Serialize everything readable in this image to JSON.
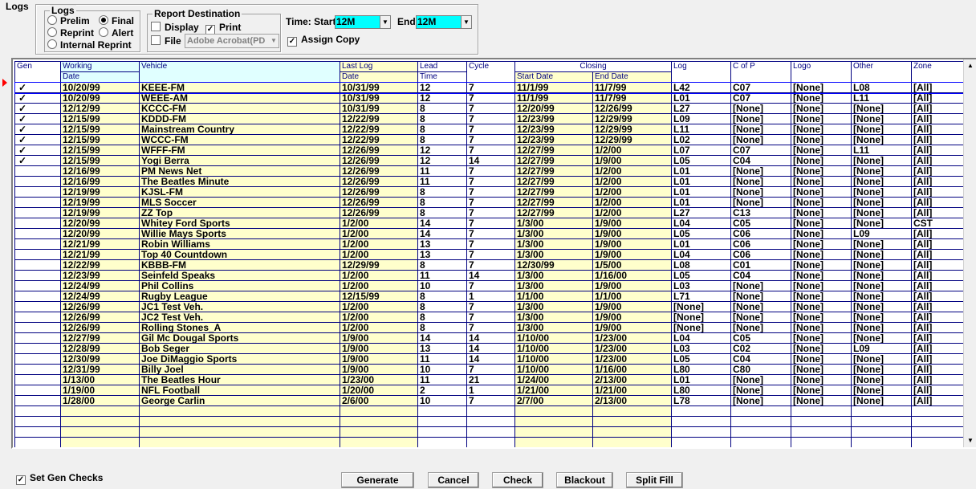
{
  "logs_group": {
    "title": "Logs",
    "kind_label": "Logs",
    "options": [
      {
        "label": "Prelim",
        "checked": false
      },
      {
        "label": "Final",
        "checked": true
      },
      {
        "label": "Reprint",
        "checked": false
      },
      {
        "label": "Alert",
        "checked": false
      },
      {
        "label": "Internal Reprint",
        "checked": false
      }
    ]
  },
  "report_destination": {
    "title": "Report Destination",
    "display_label": "Display",
    "print_label": "Print",
    "file_label": "File",
    "file_format_value": "Adobe Acrobat(PD",
    "display_checked": false,
    "print_checked": true,
    "file_checked": false
  },
  "time": {
    "start_label": "Time: Start",
    "start_value": "12M",
    "end_label": "End",
    "end_value": "12M",
    "assign_copy_label": "Assign Copy",
    "assign_copy_checked": true
  },
  "grid": {
    "headers": {
      "gen": "Gen",
      "working": "Working",
      "working_sub": "Date",
      "vehicle": "Vehicle",
      "last_log": "Last Log",
      "last_log_sub": "Date",
      "lead": "Lead",
      "lead_sub": "Time",
      "cycle": "Cycle",
      "closing": "Closing",
      "start_date": "Start Date",
      "end_date": "End Date",
      "log": "Log",
      "cofp": "C of P",
      "logo": "Logo",
      "other": "Other",
      "zone": "Zone"
    },
    "rows": [
      {
        "gen": "✓",
        "wd": "10/20/99",
        "veh": "KEEE-FM",
        "lld": "10/31/99",
        "lead": "12",
        "cyc": "7",
        "sd": "11/1/99",
        "ed": "11/7/99",
        "log": "L42",
        "cofp": "C07",
        "logo": "[None]",
        "other": "L08",
        "zone": "[All]"
      },
      {
        "gen": "✓",
        "wd": "10/20/99",
        "veh": "WEEE-AM",
        "lld": "10/31/99",
        "lead": "12",
        "cyc": "7",
        "sd": "11/1/99",
        "ed": "11/7/99",
        "log": "L01",
        "cofp": "C07",
        "logo": "[None]",
        "other": "L11",
        "zone": "[All]"
      },
      {
        "gen": "✓",
        "wd": "12/12/99",
        "veh": "KCCC-FM",
        "lld": "10/31/99",
        "lead": "8",
        "cyc": "7",
        "sd": "12/20/99",
        "ed": "12/26/99",
        "log": "L27",
        "cofp": "[None]",
        "logo": "[None]",
        "other": "[None]",
        "zone": "[All]"
      },
      {
        "gen": "✓",
        "wd": "12/15/99",
        "veh": "KDDD-FM",
        "lld": "12/22/99",
        "lead": "8",
        "cyc": "7",
        "sd": "12/23/99",
        "ed": "12/29/99",
        "log": "L09",
        "cofp": "[None]",
        "logo": "[None]",
        "other": "[None]",
        "zone": "[All]"
      },
      {
        "gen": "✓",
        "wd": "12/15/99",
        "veh": "Mainstream Country",
        "lld": "12/22/99",
        "lead": "8",
        "cyc": "7",
        "sd": "12/23/99",
        "ed": "12/29/99",
        "log": "L11",
        "cofp": "[None]",
        "logo": "[None]",
        "other": "[None]",
        "zone": "[All]"
      },
      {
        "gen": "✓",
        "wd": "12/15/99",
        "veh": "WCCC-FM",
        "lld": "12/22/99",
        "lead": "8",
        "cyc": "7",
        "sd": "12/23/99",
        "ed": "12/29/99",
        "log": "L02",
        "cofp": "[None]",
        "logo": "[None]",
        "other": "[None]",
        "zone": "[All]"
      },
      {
        "gen": "✓",
        "wd": "12/15/99",
        "veh": "WFFF-FM",
        "lld": "12/26/99",
        "lead": "12",
        "cyc": "7",
        "sd": "12/27/99",
        "ed": "1/2/00",
        "log": "L07",
        "cofp": "C07",
        "logo": "[None]",
        "other": "L11",
        "zone": "[All]"
      },
      {
        "gen": "✓",
        "wd": "12/15/99",
        "veh": "Yogi Berra",
        "lld": "12/26/99",
        "lead": "12",
        "cyc": "14",
        "sd": "12/27/99",
        "ed": "1/9/00",
        "log": "L05",
        "cofp": "C04",
        "logo": "[None]",
        "other": "[None]",
        "zone": "[All]"
      },
      {
        "gen": "",
        "wd": "12/16/99",
        "veh": "PM News Net",
        "lld": "12/26/99",
        "lead": "11",
        "cyc": "7",
        "sd": "12/27/99",
        "ed": "1/2/00",
        "log": "L01",
        "cofp": "[None]",
        "logo": "[None]",
        "other": "[None]",
        "zone": "[All]"
      },
      {
        "gen": "",
        "wd": "12/16/99",
        "veh": "The Beatles Minute",
        "lld": "12/26/99",
        "lead": "11",
        "cyc": "7",
        "sd": "12/27/99",
        "ed": "1/2/00",
        "log": "L01",
        "cofp": "[None]",
        "logo": "[None]",
        "other": "[None]",
        "zone": "[All]"
      },
      {
        "gen": "",
        "wd": "12/19/99",
        "veh": "KJSL-FM",
        "lld": "12/26/99",
        "lead": "8",
        "cyc": "7",
        "sd": "12/27/99",
        "ed": "1/2/00",
        "log": "L01",
        "cofp": "[None]",
        "logo": "[None]",
        "other": "[None]",
        "zone": "[All]"
      },
      {
        "gen": "",
        "wd": "12/19/99",
        "veh": "MLS Soccer",
        "lld": "12/26/99",
        "lead": "8",
        "cyc": "7",
        "sd": "12/27/99",
        "ed": "1/2/00",
        "log": "L01",
        "cofp": "[None]",
        "logo": "[None]",
        "other": "[None]",
        "zone": "[All]"
      },
      {
        "gen": "",
        "wd": "12/19/99",
        "veh": "ZZ Top",
        "lld": "12/26/99",
        "lead": "8",
        "cyc": "7",
        "sd": "12/27/99",
        "ed": "1/2/00",
        "log": "L27",
        "cofp": "C13",
        "logo": "[None]",
        "other": "[None]",
        "zone": "[All]"
      },
      {
        "gen": "",
        "wd": "12/20/99",
        "veh": "Whitey Ford Sports",
        "lld": "1/2/00",
        "lead": "14",
        "cyc": "7",
        "sd": "1/3/00",
        "ed": "1/9/00",
        "log": "L04",
        "cofp": "C05",
        "logo": "[None]",
        "other": "[None]",
        "zone": "CST"
      },
      {
        "gen": "",
        "wd": "12/20/99",
        "veh": "Willie Mays Sports",
        "lld": "1/2/00",
        "lead": "14",
        "cyc": "7",
        "sd": "1/3/00",
        "ed": "1/9/00",
        "log": "L05",
        "cofp": "C06",
        "logo": "[None]",
        "other": "L09",
        "zone": "[All]"
      },
      {
        "gen": "",
        "wd": "12/21/99",
        "veh": "Robin Williams",
        "lld": "1/2/00",
        "lead": "13",
        "cyc": "7",
        "sd": "1/3/00",
        "ed": "1/9/00",
        "log": "L01",
        "cofp": "C06",
        "logo": "[None]",
        "other": "[None]",
        "zone": "[All]"
      },
      {
        "gen": "",
        "wd": "12/21/99",
        "veh": "Top 40 Countdown",
        "lld": "1/2/00",
        "lead": "13",
        "cyc": "7",
        "sd": "1/3/00",
        "ed": "1/9/00",
        "log": "L04",
        "cofp": "C06",
        "logo": "[None]",
        "other": "[None]",
        "zone": "[All]"
      },
      {
        "gen": "",
        "wd": "12/22/99",
        "veh": "KBBB-FM",
        "lld": "12/29/99",
        "lead": "8",
        "cyc": "7",
        "sd": "12/30/99",
        "ed": "1/5/00",
        "log": "L08",
        "cofp": "C01",
        "logo": "[None]",
        "other": "[None]",
        "zone": "[All]"
      },
      {
        "gen": "",
        "wd": "12/23/99",
        "veh": "Seinfeld Speaks",
        "lld": "1/2/00",
        "lead": "11",
        "cyc": "14",
        "sd": "1/3/00",
        "ed": "1/16/00",
        "log": "L05",
        "cofp": "C04",
        "logo": "[None]",
        "other": "[None]",
        "zone": "[All]"
      },
      {
        "gen": "",
        "wd": "12/24/99",
        "veh": "Phil Collins",
        "lld": "1/2/00",
        "lead": "10",
        "cyc": "7",
        "sd": "1/3/00",
        "ed": "1/9/00",
        "log": "L03",
        "cofp": "[None]",
        "logo": "[None]",
        "other": "[None]",
        "zone": "[All]"
      },
      {
        "gen": "",
        "wd": "12/24/99",
        "veh": "Rugby League",
        "lld": "12/15/99",
        "lead": "8",
        "cyc": "1",
        "sd": "1/1/00",
        "ed": "1/1/00",
        "log": "L71",
        "cofp": "[None]",
        "logo": "[None]",
        "other": "[None]",
        "zone": "[All]"
      },
      {
        "gen": "",
        "wd": "12/26/99",
        "veh": "JC1 Test Veh.",
        "lld": "1/2/00",
        "lead": "8",
        "cyc": "7",
        "sd": "1/3/00",
        "ed": "1/9/00",
        "log": "[None]",
        "cofp": "[None]",
        "logo": "[None]",
        "other": "[None]",
        "zone": "[All]"
      },
      {
        "gen": "",
        "wd": "12/26/99",
        "veh": "JC2 Test Veh.",
        "lld": "1/2/00",
        "lead": "8",
        "cyc": "7",
        "sd": "1/3/00",
        "ed": "1/9/00",
        "log": "[None]",
        "cofp": "[None]",
        "logo": "[None]",
        "other": "[None]",
        "zone": "[All]"
      },
      {
        "gen": "",
        "wd": "12/26/99",
        "veh": "Rolling Stones_A",
        "lld": "1/2/00",
        "lead": "8",
        "cyc": "7",
        "sd": "1/3/00",
        "ed": "1/9/00",
        "log": "[None]",
        "cofp": "[None]",
        "logo": "[None]",
        "other": "[None]",
        "zone": "[All]"
      },
      {
        "gen": "",
        "wd": "12/27/99",
        "veh": "Gil Mc Dougal Sports",
        "lld": "1/9/00",
        "lead": "14",
        "cyc": "14",
        "sd": "1/10/00",
        "ed": "1/23/00",
        "log": "L04",
        "cofp": "C05",
        "logo": "[None]",
        "other": "[None]",
        "zone": "[All]"
      },
      {
        "gen": "",
        "wd": "12/28/99",
        "veh": "Bob Seger",
        "lld": "1/9/00",
        "lead": "13",
        "cyc": "14",
        "sd": "1/10/00",
        "ed": "1/23/00",
        "log": "L03",
        "cofp": "C02",
        "logo": "[None]",
        "other": "L09",
        "zone": "[All]"
      },
      {
        "gen": "",
        "wd": "12/30/99",
        "veh": "Joe DiMaggio Sports",
        "lld": "1/9/00",
        "lead": "11",
        "cyc": "14",
        "sd": "1/10/00",
        "ed": "1/23/00",
        "log": "L05",
        "cofp": "C04",
        "logo": "[None]",
        "other": "[None]",
        "zone": "[All]"
      },
      {
        "gen": "",
        "wd": "12/31/99",
        "veh": "Billy Joel",
        "lld": "1/9/00",
        "lead": "10",
        "cyc": "7",
        "sd": "1/10/00",
        "ed": "1/16/00",
        "log": "L80",
        "cofp": "C80",
        "logo": "[None]",
        "other": "[None]",
        "zone": "[All]"
      },
      {
        "gen": "",
        "wd": "1/13/00",
        "veh": "The Beatles Hour",
        "lld": "1/23/00",
        "lead": "11",
        "cyc": "21",
        "sd": "1/24/00",
        "ed": "2/13/00",
        "log": "L01",
        "cofp": "[None]",
        "logo": "[None]",
        "other": "[None]",
        "zone": "[All]"
      },
      {
        "gen": "",
        "wd": "1/19/00",
        "veh": "NFL Football",
        "lld": "1/20/00",
        "lead": "2",
        "cyc": "1",
        "sd": "1/21/00",
        "ed": "1/21/00",
        "log": "L80",
        "cofp": "[None]",
        "logo": "[None]",
        "other": "[None]",
        "zone": "[All]"
      },
      {
        "gen": "",
        "wd": "1/28/00",
        "veh": "George Carlin",
        "lld": "2/6/00",
        "lead": "10",
        "cyc": "7",
        "sd": "2/7/00",
        "ed": "2/13/00",
        "log": "L78",
        "cofp": "[None]",
        "logo": "[None]",
        "other": "[None]",
        "zone": "[All]"
      }
    ],
    "empty_rows": 4
  },
  "set_gen_checks": {
    "label": "Set Gen Checks",
    "checked": true
  },
  "buttons": {
    "generate": "Generate",
    "cancel": "Cancel",
    "check": "Check",
    "blackout": "Blackout",
    "split_fill": "Split Fill"
  },
  "colors": {
    "accent_cyan": "#00ffff",
    "row_yellow": "#ffffcc",
    "grid_line": "#000080",
    "marker": "#ff0000"
  }
}
